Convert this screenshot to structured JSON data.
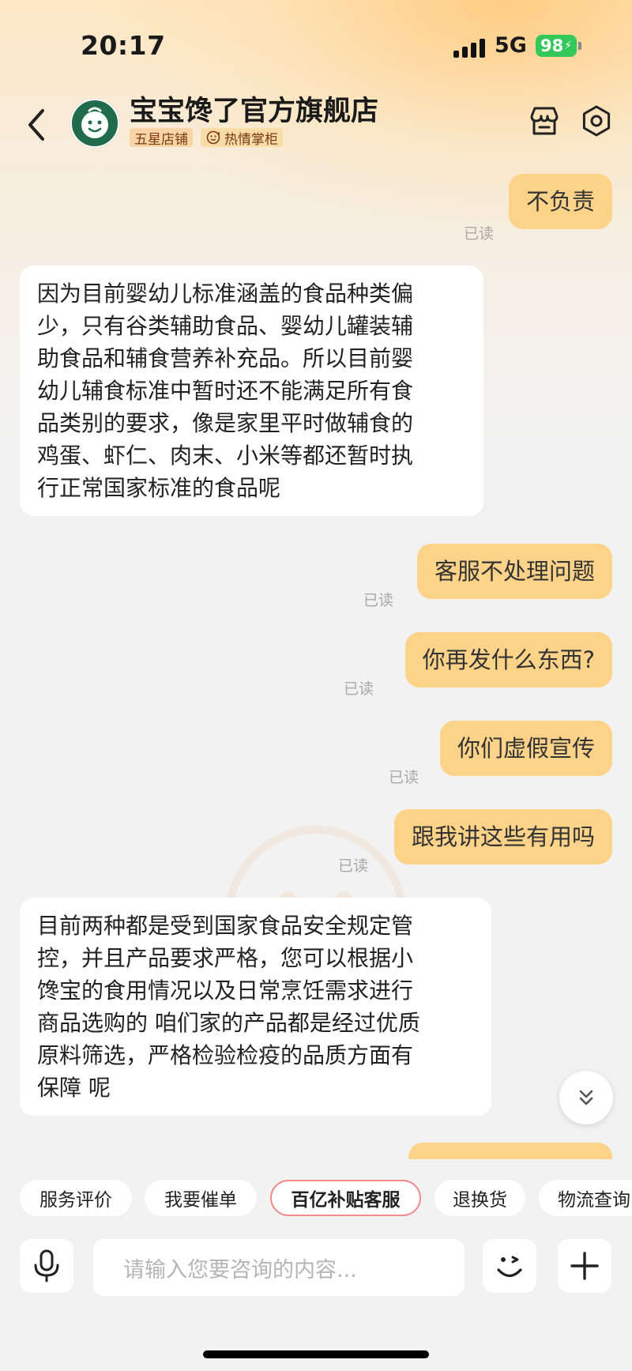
{
  "status_bar": {
    "time": "20:17",
    "network": "5G",
    "battery": "98"
  },
  "header": {
    "store_name": "宝宝馋了官方旗舰店",
    "badges": [
      "五星店铺",
      "热情掌柜"
    ]
  },
  "messages": [
    {
      "side": "right",
      "text": "不负责",
      "status": "已读"
    },
    {
      "side": "left",
      "lines": [
        "因为目前婴幼儿标准涵盖的食品种类偏",
        "少，只有谷类辅助食品、婴幼儿罐装辅",
        "助食品和辅食营养补充品。所以目前婴",
        "幼儿辅食标准中暂时还不能满足所有食",
        "品类别的要求，像是家里平时做辅食的",
        "鸡蛋、虾仁、肉末、小米等都还暂时执",
        "行正常国家标准的食品呢"
      ]
    },
    {
      "side": "right",
      "text": "客服不处理问题",
      "status": "已读"
    },
    {
      "side": "right",
      "text": "你再发什么东西?",
      "status": "已读"
    },
    {
      "side": "right",
      "text": "你们虚假宣传",
      "status": "已读"
    },
    {
      "side": "right",
      "text": "跟我讲这些有用吗",
      "status": "已读"
    },
    {
      "side": "left",
      "lines": [
        "目前两种都是受到国家食品安全规定管",
        "控，并且产品要求严格，您可以根据小",
        "馋宝的食用情况以及日常烹饪需求进行",
        "商品选购的 咱们家的产品都是经过优质",
        "原料筛选，严格检验检疫的品质方面有",
        "保障 呢"
      ]
    }
  ],
  "quick_replies": [
    "服务评价",
    "我要催单",
    "百亿补贴客服",
    "退换货",
    "物流查询"
  ],
  "input": {
    "placeholder": "请输入您要咨询的内容..."
  },
  "colors": {
    "bubble_right": "#fdd289",
    "bubble_left": "#ffffff",
    "battery": "#34c759",
    "active_chip_border": "#f28a8a"
  }
}
